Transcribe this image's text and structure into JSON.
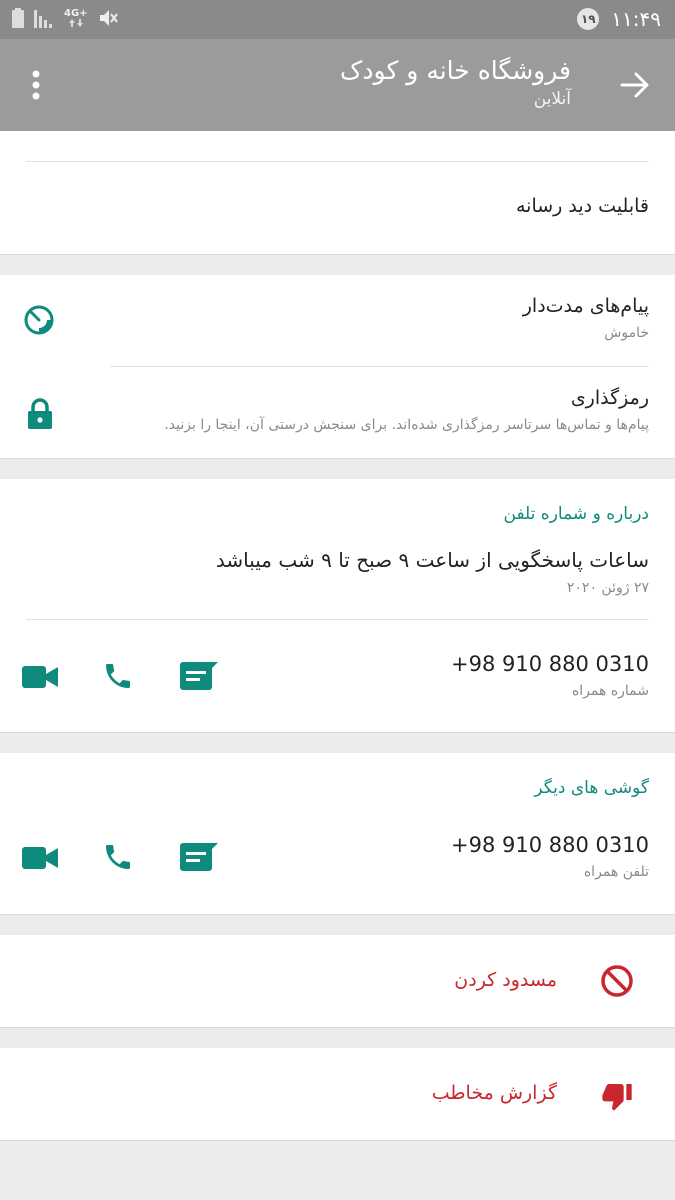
{
  "status_bar": {
    "time": "۱۱:۴۹",
    "badge": "۱۹",
    "network": "4G+",
    "icons": [
      "battery-icon",
      "signal-icon",
      "network-4g-icon",
      "mute-icon"
    ]
  },
  "header": {
    "title": "فروشگاه خانه و کودک",
    "subtitle": "آنلاین",
    "icons": [
      "back-arrow-icon",
      "more-vert-icon"
    ]
  },
  "media_visibility": {
    "label": "قابلیت دید رسانه"
  },
  "privacy": {
    "disappearing": {
      "title": "پیام‌های مدت‌دار",
      "status": "خاموش",
      "icon": "timer-icon"
    },
    "encryption": {
      "title": "رمزگذاری",
      "description": "پیام‌ها و تماس‌ها سرتاسر رمزگذاری شده‌اند. برای سنجش درستی آن، اینجا را بزنید.",
      "icon": "lock-icon"
    }
  },
  "about": {
    "heading": "درباره و شماره تلفن",
    "text": "ساعات پاسخگویی از ساعت ۹ صبح تا ۹ شب میباشد",
    "date": "۲۷ ژوئن ۲۰۲۰",
    "phone": {
      "number": "+98 910 880 0310",
      "type": "شماره همراه"
    }
  },
  "other_phones": {
    "heading": "گوشی های دیگر",
    "phone": {
      "number": "+98 910 880 0310",
      "type": "تلفن همراه"
    }
  },
  "actions": {
    "block": {
      "label": "مسدود کردن",
      "icon": "block-icon"
    },
    "report": {
      "label": "گزارش مخاطب",
      "icon": "thumb-down-icon"
    }
  },
  "colors": {
    "accent": "#0f8b7e",
    "danger": "#c9272d",
    "appbar": "#9b9b9b",
    "statusbar": "#8a8a8a"
  }
}
